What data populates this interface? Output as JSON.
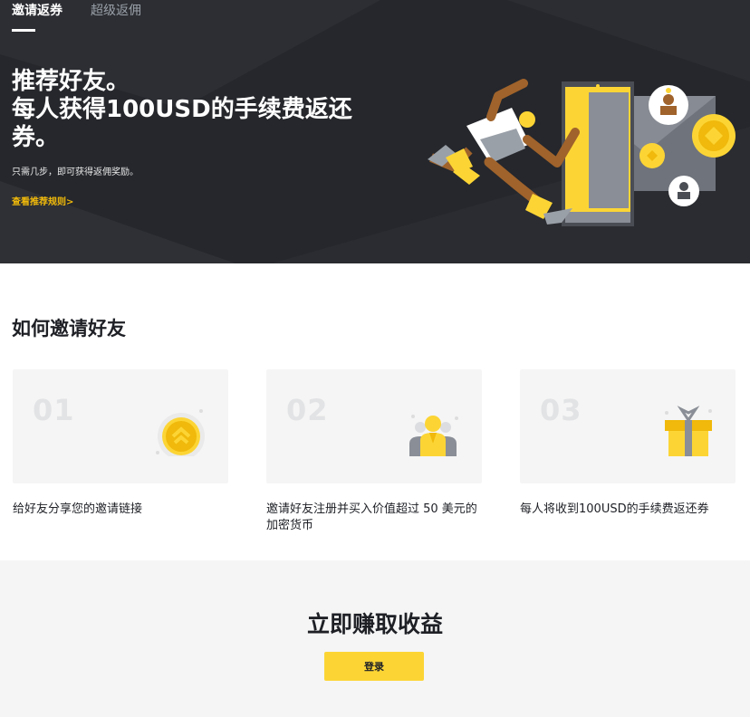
{
  "tabs": [
    {
      "label": "邀请返券",
      "active": true
    },
    {
      "label": "超级返佣",
      "active": false
    }
  ],
  "hero": {
    "title_lines": [
      "推荐好友。",
      "每人获得100USD的手续费返还",
      "券。"
    ],
    "subtitle": "只需几步，即可获得返佣奖励。",
    "rules_link": "查看推荐规则>"
  },
  "how": {
    "title": "如何邀请好友",
    "steps": [
      {
        "number": "01",
        "text": "给好友分享您的邀请链接",
        "icon": "coin-icon"
      },
      {
        "number": "02",
        "text": "邀请好友注册并买入价值超过 50 美元的加密货币",
        "icon": "people-icon"
      },
      {
        "number": "03",
        "text": "每人将收到100USD的手续费返还券",
        "icon": "gift-icon"
      }
    ]
  },
  "cta": {
    "title": "立即赚取收益",
    "button_label": "登录"
  },
  "colors": {
    "hero_bg": "#25272c",
    "accent_yellow": "#fcd535",
    "link_yellow": "#f0b90b",
    "brown": "#a0632b"
  }
}
